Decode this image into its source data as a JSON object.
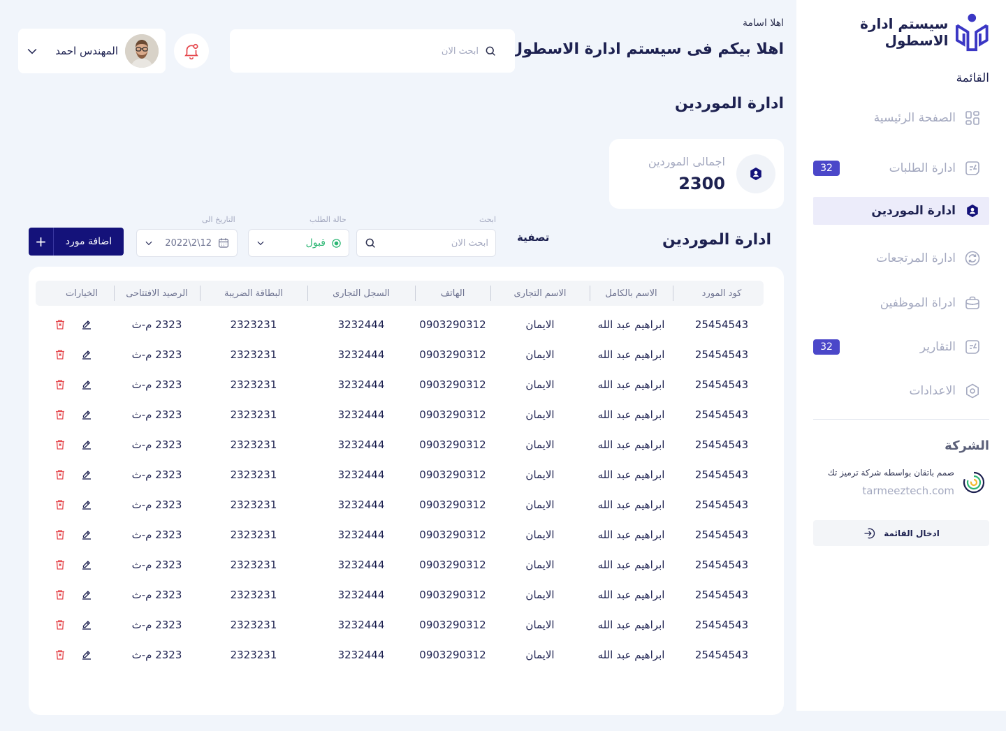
{
  "sidebar": {
    "brand_title": "سيستم ادارة الاسطول",
    "menu_heading": "القائمة",
    "items": [
      {
        "label": "الصفحة الرئيسية",
        "icon": "grid-icon",
        "badge": null,
        "active": false
      },
      {
        "label": "ادارة الطلبات",
        "icon": "orders-icon",
        "badge": "32",
        "active": false
      },
      {
        "label": "ادارة الموردين",
        "icon": "supplier-icon",
        "badge": null,
        "active": true
      },
      {
        "label": "ادارة المرتجعات",
        "icon": "returns-icon",
        "badge": null,
        "active": false
      },
      {
        "label": "ادراة الموظفين",
        "icon": "briefcase-icon",
        "badge": null,
        "active": false
      },
      {
        "label": "التقارير",
        "icon": "reports-icon",
        "badge": "32",
        "active": false
      },
      {
        "label": "الاعدادات",
        "icon": "settings-icon",
        "badge": null,
        "active": false
      }
    ],
    "company_heading": "الشركة",
    "company_credit": "صمم باتقان بواسطه شركة ترميز تك",
    "company_site": "tarmeeztech.com",
    "enter_menu": "ادخال القائمة"
  },
  "header": {
    "greeting_small": "اهلا اسامة",
    "greeting_big": "اهلا بيكم فى سيستم ادارة الاسطول",
    "search_placeholder": "ابحث الان",
    "user_name": "المهندس احمد"
  },
  "page": {
    "title": "ادارة الموردين",
    "stat_label": "اجمالى الموردين",
    "stat_value": "2300"
  },
  "filters": {
    "section_title": "ادارة الموردين",
    "filter_title": "تصفية",
    "search_label": "ابحث",
    "search_placeholder": "ابحث الان",
    "status_label": "حالة الطلب",
    "status_value": "قبول",
    "date_label": "التاريخ الى",
    "date_value": "12\\2\\2022",
    "add_button": "اضافة مورد"
  },
  "table": {
    "columns": [
      "كود المورد",
      "الاسم بالكامل",
      "الاسم التجارى",
      "الهاتف",
      "السجل التجارى",
      "البطاقة الضريبة",
      "الرصيد الافتتاحى",
      "الخيارات"
    ],
    "rows": [
      [
        "25454543",
        "ابراهيم عبد الله",
        "الايمان",
        "0903290312",
        "3232444",
        "2323231",
        "2323 م-ث"
      ],
      [
        "25454543",
        "ابراهيم عبد الله",
        "الايمان",
        "0903290312",
        "3232444",
        "2323231",
        "2323 م-ث"
      ],
      [
        "25454543",
        "ابراهيم عبد الله",
        "الايمان",
        "0903290312",
        "3232444",
        "2323231",
        "2323 م-ث"
      ],
      [
        "25454543",
        "ابراهيم عبد الله",
        "الايمان",
        "0903290312",
        "3232444",
        "2323231",
        "2323 م-ث"
      ],
      [
        "25454543",
        "ابراهيم عبد الله",
        "الايمان",
        "0903290312",
        "3232444",
        "2323231",
        "2323 م-ث"
      ],
      [
        "25454543",
        "ابراهيم عبد الله",
        "الايمان",
        "0903290312",
        "3232444",
        "2323231",
        "2323 م-ث"
      ],
      [
        "25454543",
        "ابراهيم عبد الله",
        "الايمان",
        "0903290312",
        "3232444",
        "2323231",
        "2323 م-ث"
      ],
      [
        "25454543",
        "ابراهيم عبد الله",
        "الايمان",
        "0903290312",
        "3232444",
        "2323231",
        "2323 م-ث"
      ],
      [
        "25454543",
        "ابراهيم عبد الله",
        "الايمان",
        "0903290312",
        "3232444",
        "2323231",
        "2323 م-ث"
      ],
      [
        "25454543",
        "ابراهيم عبد الله",
        "الايمان",
        "0903290312",
        "3232444",
        "2323231",
        "2323 م-ث"
      ],
      [
        "25454543",
        "ابراهيم عبد الله",
        "الايمان",
        "0903290312",
        "3232444",
        "2323231",
        "2323 م-ث"
      ],
      [
        "25454543",
        "ابراهيم عبد الله",
        "الايمان",
        "0903290312",
        "3232444",
        "2323231",
        "2323 م-ث"
      ]
    ]
  },
  "colors": {
    "primary": "#14127a",
    "accent": "#4b47c9",
    "success": "#2bb673",
    "danger": "#e5484d",
    "muted": "#a3a8bf",
    "background": "#f1f5fb"
  }
}
